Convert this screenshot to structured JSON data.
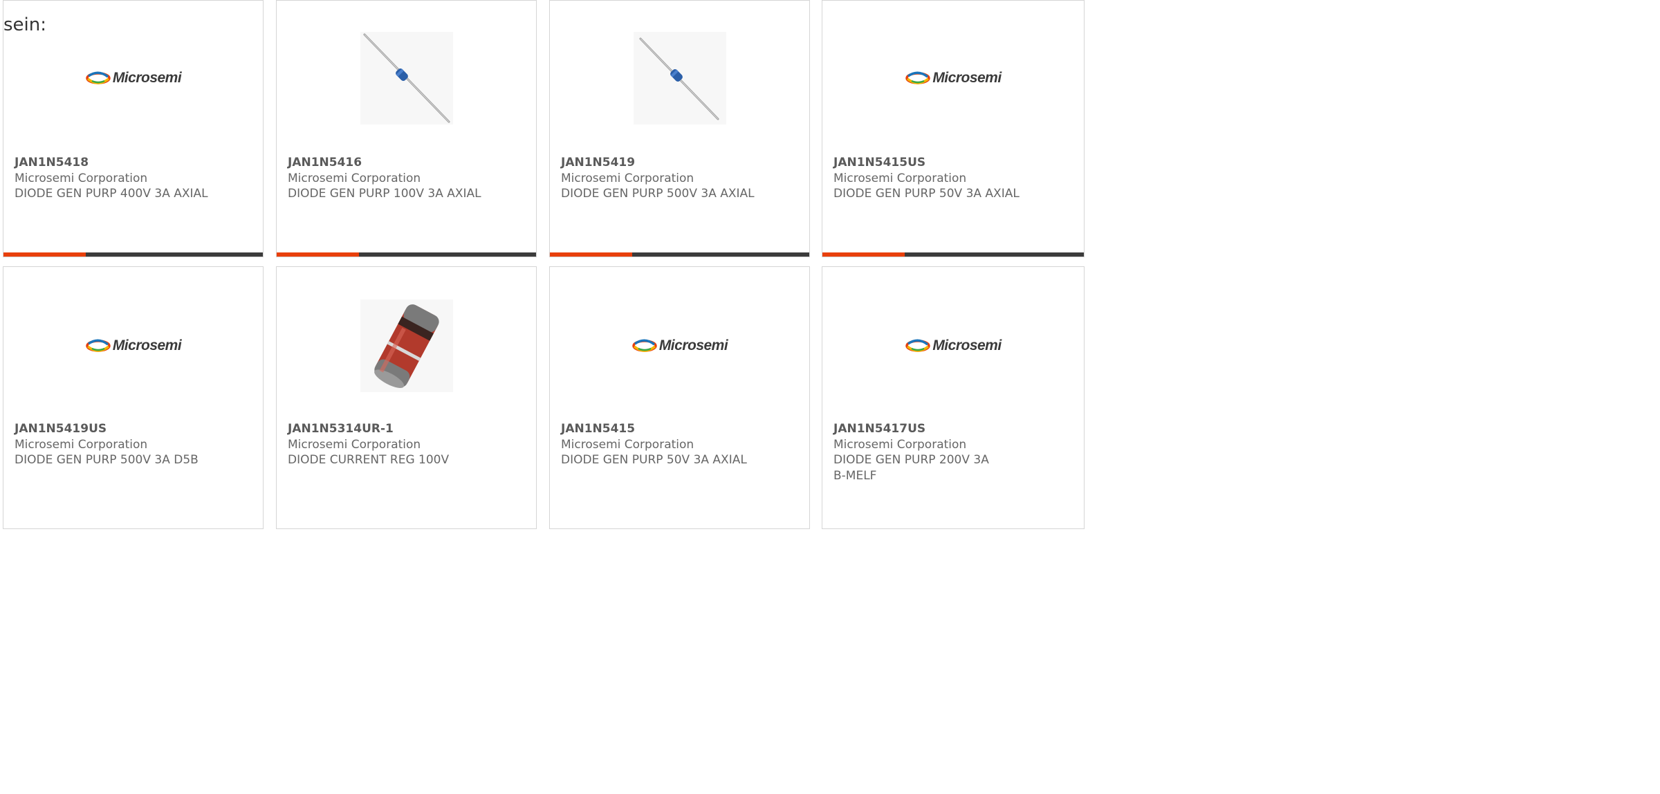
{
  "intro_text": "sein:",
  "accent_color": "#e8400c",
  "bar_color": "#3b3b3b",
  "cards": [
    {
      "part": "JAN1N5418",
      "manufacturer": "Microsemi Corporation",
      "description": "DIODE GEN PURP 400V 3A AXIAL",
      "image": "microsemi-logo",
      "logo_text": "Microsemi"
    },
    {
      "part": "JAN1N5416",
      "manufacturer": "Microsemi Corporation",
      "description": "DIODE GEN PURP 100V 3A AXIAL",
      "image": "axial-diode-photo"
    },
    {
      "part": "JAN1N5419",
      "manufacturer": "Microsemi Corporation",
      "description": "DIODE GEN PURP 500V 3A AXIAL",
      "image": "axial-diode-photo"
    },
    {
      "part": "JAN1N5415US",
      "manufacturer": "Microsemi Corporation",
      "description": "DIODE GEN PURP 50V 3A AXIAL",
      "image": "microsemi-logo",
      "logo_text": "Microsemi"
    },
    {
      "part": "JAN1N5419US",
      "manufacturer": "Microsemi Corporation",
      "description": "DIODE GEN PURP 500V 3A D5B",
      "image": "microsemi-logo",
      "logo_text": "Microsemi"
    },
    {
      "part": "JAN1N5314UR-1",
      "manufacturer": "Microsemi Corporation",
      "description": "DIODE CURRENT REG 100V",
      "image": "melf-diode-photo"
    },
    {
      "part": "JAN1N5415",
      "manufacturer": "Microsemi Corporation",
      "description": "DIODE GEN PURP 50V 3A AXIAL",
      "image": "microsemi-logo",
      "logo_text": "Microsemi"
    },
    {
      "part": "JAN1N5417US",
      "manufacturer": "Microsemi Corporation",
      "description": "DIODE GEN PURP 200V 3A B-MELF",
      "image": "microsemi-logo",
      "logo_text": "Microsemi"
    }
  ]
}
